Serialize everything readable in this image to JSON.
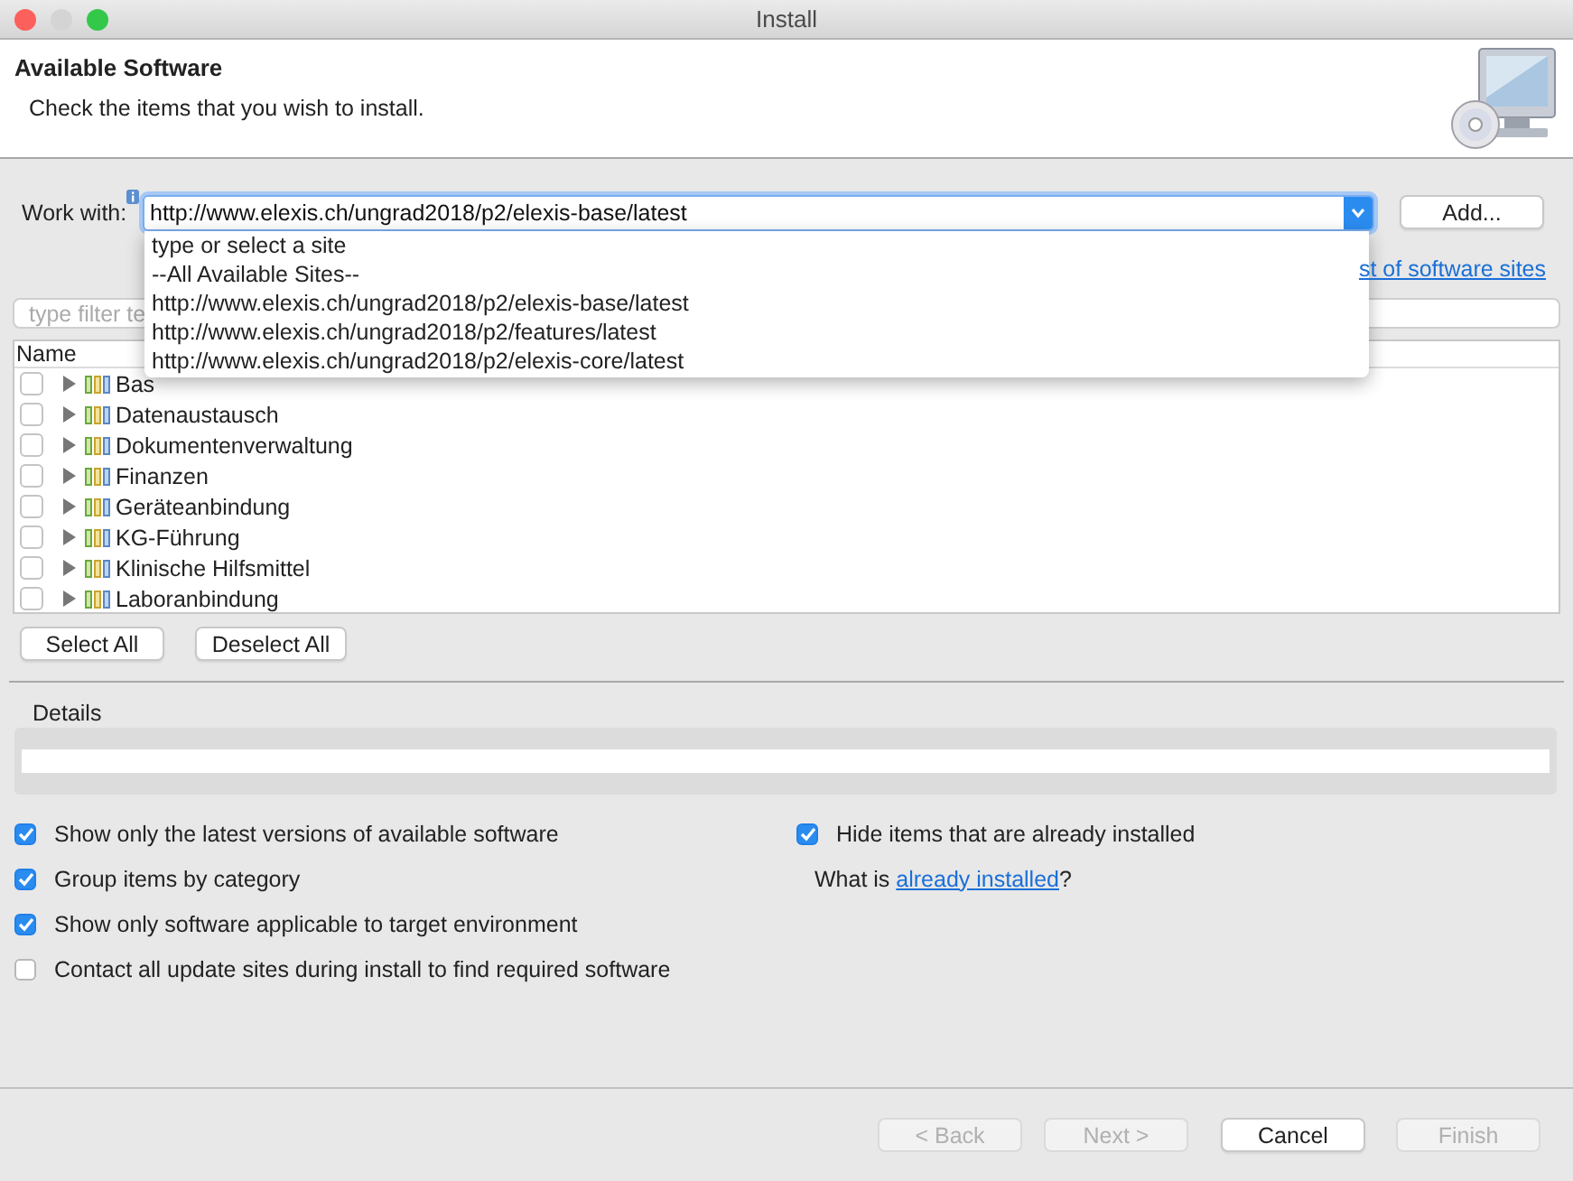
{
  "window": {
    "title": "Install"
  },
  "header": {
    "title": "Available Software",
    "subtitle": "Check the items that you wish to install."
  },
  "work_with": {
    "label": "Work with:",
    "value": "http://www.elexis.ch/ungrad2018/p2/elexis-base/latest",
    "add_button": "Add...",
    "link": "st of software sites",
    "expanded": true,
    "dropdown_options": [
      "type or select a site",
      "--All Available Sites--",
      "http://www.elexis.ch/ungrad2018/p2/elexis-base/latest",
      "http://www.elexis.ch/ungrad2018/p2/features/latest",
      "http://www.elexis.ch/ungrad2018/p2/elexis-core/latest"
    ]
  },
  "filter": {
    "placeholder": "type filter te"
  },
  "tree": {
    "column": "Name",
    "rows": [
      {
        "label": "Bas",
        "checked": false,
        "expanded": false
      },
      {
        "label": "Datenaustausch",
        "checked": false,
        "expanded": false
      },
      {
        "label": "Dokumentenverwaltung",
        "checked": false,
        "expanded": false
      },
      {
        "label": "Finanzen",
        "checked": false,
        "expanded": false
      },
      {
        "label": "Geräteanbindung",
        "checked": false,
        "expanded": false
      },
      {
        "label": "KG-Führung",
        "checked": false,
        "expanded": false
      },
      {
        "label": "Klinische Hilfsmittel",
        "checked": false,
        "expanded": false
      },
      {
        "label": "Laboranbindung",
        "checked": false,
        "expanded": false
      }
    ]
  },
  "selection_buttons": [
    "Select All",
    "Deselect All"
  ],
  "details": {
    "label": "Details"
  },
  "options_left": [
    {
      "label": "Show only the latest versions of available software",
      "checked": true
    },
    {
      "label": "Group items by category",
      "checked": true
    },
    {
      "label": "Show only software applicable to target environment",
      "checked": true
    },
    {
      "label": "Contact all update sites during install to find required software",
      "checked": false
    }
  ],
  "options_right": [
    {
      "label": "Hide items that are already installed",
      "checked": true
    }
  ],
  "installed_note": {
    "before": "What is ",
    "link": "already installed",
    "after": "?"
  },
  "footer_buttons": [
    {
      "label": "< Back",
      "disabled": true
    },
    {
      "label": "Next >",
      "disabled": true
    },
    {
      "label": "Cancel",
      "disabled": false
    },
    {
      "label": "Finish",
      "disabled": true
    }
  ]
}
